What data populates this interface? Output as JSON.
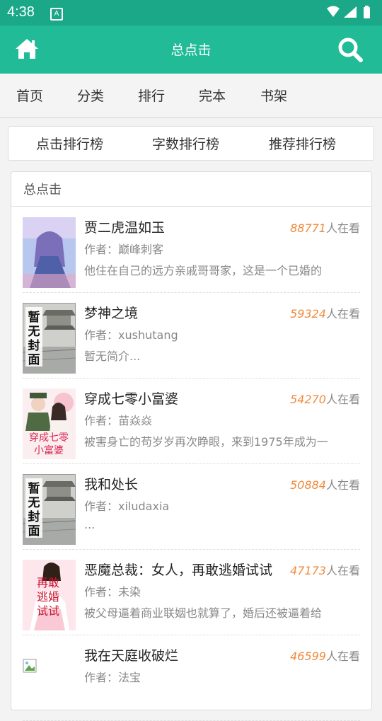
{
  "status": {
    "time": "4:38",
    "app_icon_letter": "A"
  },
  "header": {
    "title": "总点击"
  },
  "nav": {
    "items": [
      "首页",
      "分类",
      "排行",
      "完本",
      "书架"
    ]
  },
  "rank_tabs": [
    "点击排行榜",
    "字数排行榜",
    "推荐排行榜"
  ],
  "panel": {
    "title": "总点击"
  },
  "views_suffix": "人在看",
  "author_prefix": "作者：",
  "books": [
    {
      "title": "贾二虎温如玉",
      "count": "88771",
      "author": "巅峰刺客",
      "desc": "他住在自己的远方亲戚哥哥家，这是一个已婚的",
      "cover": "anime"
    },
    {
      "title": "梦神之境",
      "count": "59324",
      "author": "xushutang",
      "desc": "暂无简介...",
      "cover": "none"
    },
    {
      "title": "穿成七零小富婆",
      "count": "54270",
      "author": "苗焱焱",
      "desc": "被害身亡的苟岁岁再次睁眼，来到1975年成为一",
      "cover": "romance"
    },
    {
      "title": "我和处长",
      "count": "50884",
      "author": "xiludaxia",
      "desc": "...",
      "cover": "none"
    },
    {
      "title": "恶魔总裁：女人，再敢逃婚试试",
      "count": "47173",
      "author": "未染",
      "desc": "被父母逼着商业联姻也就算了，婚后还被逼着给",
      "cover": "bride"
    },
    {
      "title": "我在天庭收破烂",
      "count": "46599",
      "author": "法宝",
      "desc": "",
      "cover": "broken"
    }
  ],
  "cover_text": {
    "none": "暂无封面",
    "romance": "穿成七零小富婆",
    "bride": "再敢逃婚试试"
  }
}
